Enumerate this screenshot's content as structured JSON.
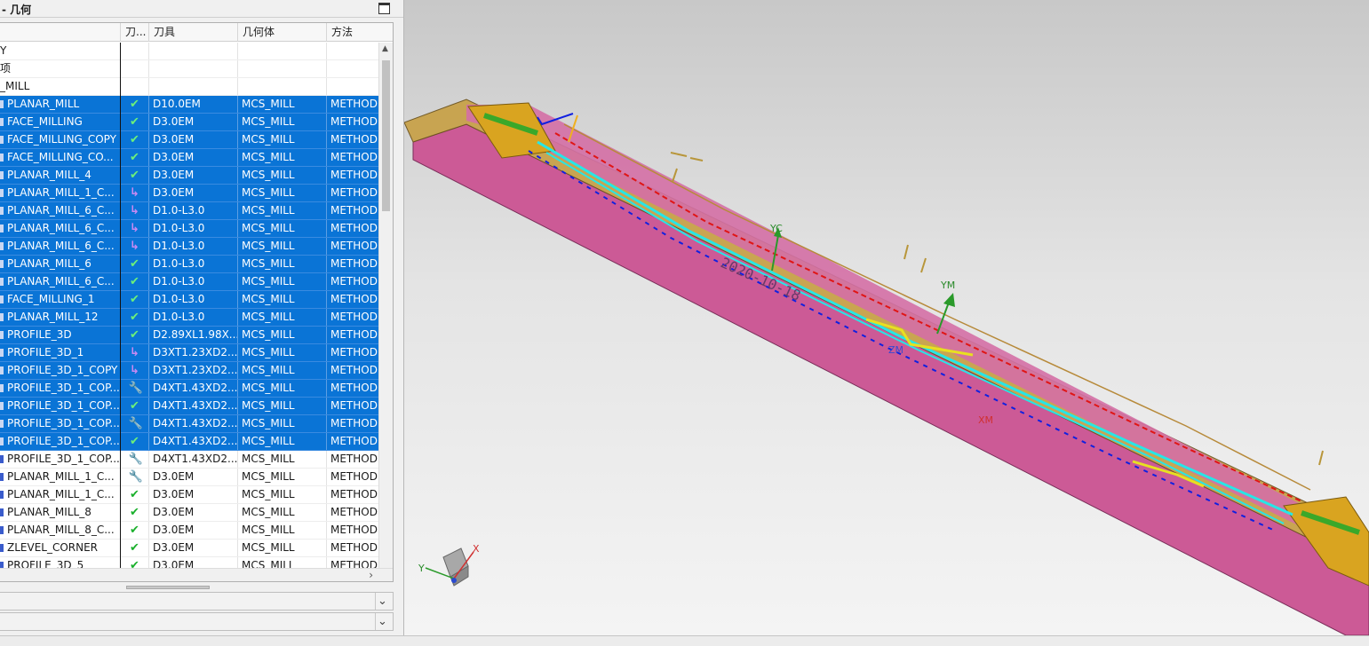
{
  "navigator": {
    "title": "- 几何",
    "columns": [
      "",
      "刀...",
      "刀具",
      "几何体",
      "方法"
    ]
  },
  "rows": [
    {
      "name": "Y",
      "status": "",
      "tool": "",
      "geometry": "",
      "method": "",
      "selected": false,
      "group": true
    },
    {
      "name": "项",
      "status": "",
      "tool": "",
      "geometry": "",
      "method": "",
      "selected": false,
      "group": true
    },
    {
      "name": "_MILL",
      "status": "",
      "tool": "",
      "geometry": "",
      "method": "",
      "selected": false,
      "group": true
    },
    {
      "name": "PLANAR_MILL",
      "status": "✔",
      "tool": "D10.0EM",
      "geometry": "MCS_MILL",
      "method": "METHOD",
      "selected": true,
      "kind": "ok"
    },
    {
      "name": "FACE_MILLING",
      "status": "✔",
      "tool": "D3.0EM",
      "geometry": "MCS_MILL",
      "method": "METHOD",
      "selected": true,
      "kind": "ok"
    },
    {
      "name": "FACE_MILLING_COPY",
      "status": "✔",
      "tool": "D3.0EM",
      "geometry": "MCS_MILL",
      "method": "METHOD",
      "selected": true,
      "kind": "ok"
    },
    {
      "name": "FACE_MILLING_CO...",
      "status": "✔",
      "tool": "D3.0EM",
      "geometry": "MCS_MILL",
      "method": "METHOD",
      "selected": true,
      "kind": "ok"
    },
    {
      "name": "PLANAR_MILL_4",
      "status": "✔",
      "tool": "D3.0EM",
      "geometry": "MCS_MILL",
      "method": "METHOD",
      "selected": true,
      "kind": "ok"
    },
    {
      "name": "PLANAR_MILL_1_C...",
      "status": "↳",
      "tool": "D3.0EM",
      "geometry": "MCS_MILL",
      "method": "METHOD",
      "selected": true,
      "kind": "rep"
    },
    {
      "name": "PLANAR_MILL_6_C...",
      "status": "↳",
      "tool": "D1.0-L3.0",
      "geometry": "MCS_MILL",
      "method": "METHOD",
      "selected": true,
      "kind": "rep"
    },
    {
      "name": "PLANAR_MILL_6_C...",
      "status": "↳",
      "tool": "D1.0-L3.0",
      "geometry": "MCS_MILL",
      "method": "METHOD",
      "selected": true,
      "kind": "rep"
    },
    {
      "name": "PLANAR_MILL_6_C...",
      "status": "↳",
      "tool": "D1.0-L3.0",
      "geometry": "MCS_MILL",
      "method": "METHOD",
      "selected": true,
      "kind": "rep"
    },
    {
      "name": "PLANAR_MILL_6",
      "status": "✔",
      "tool": "D1.0-L3.0",
      "geometry": "MCS_MILL",
      "method": "METHOD",
      "selected": true,
      "kind": "ok"
    },
    {
      "name": "PLANAR_MILL_6_C...",
      "status": "✔",
      "tool": "D1.0-L3.0",
      "geometry": "MCS_MILL",
      "method": "METHOD",
      "selected": true,
      "kind": "ok"
    },
    {
      "name": "FACE_MILLING_1",
      "status": "✔",
      "tool": "D1.0-L3.0",
      "geometry": "MCS_MILL",
      "method": "METHOD",
      "selected": true,
      "kind": "ok"
    },
    {
      "name": "PLANAR_MILL_12",
      "status": "✔",
      "tool": "D1.0-L3.0",
      "geometry": "MCS_MILL",
      "method": "METHOD",
      "selected": true,
      "kind": "ok"
    },
    {
      "name": "PROFILE_3D",
      "status": "✔",
      "tool": "D2.89XL1.98X...",
      "geometry": "MCS_MILL",
      "method": "METHOD",
      "selected": true,
      "kind": "ok"
    },
    {
      "name": "PROFILE_3D_1",
      "status": "↳",
      "tool": "D3XT1.23XD2...",
      "geometry": "MCS_MILL",
      "method": "METHOD",
      "selected": true,
      "kind": "rep"
    },
    {
      "name": "PROFILE_3D_1_COPY",
      "status": "↳",
      "tool": "D3XT1.23XD2...",
      "geometry": "MCS_MILL",
      "method": "METHOD",
      "selected": true,
      "kind": "rep"
    },
    {
      "name": "PROFILE_3D_1_COP...",
      "status": "🔧",
      "tool": "D4XT1.43XD2...",
      "geometry": "MCS_MILL",
      "method": "METHOD",
      "selected": true,
      "kind": "tool"
    },
    {
      "name": "PROFILE_3D_1_COP...",
      "status": "✔",
      "tool": "D4XT1.43XD2...",
      "geometry": "MCS_MILL",
      "method": "METHOD",
      "selected": true,
      "kind": "ok"
    },
    {
      "name": "PROFILE_3D_1_COP...",
      "status": "🔧",
      "tool": "D4XT1.43XD2...",
      "geometry": "MCS_MILL",
      "method": "METHOD",
      "selected": true,
      "kind": "tool"
    },
    {
      "name": "PROFILE_3D_1_COP...",
      "status": "✔",
      "tool": "D4XT1.43XD2...",
      "geometry": "MCS_MILL",
      "method": "METHOD",
      "selected": true,
      "kind": "ok"
    },
    {
      "name": "PROFILE_3D_1_COP...",
      "status": "🔧",
      "tool": "D4XT1.43XD2...",
      "geometry": "MCS_MILL",
      "method": "METHOD",
      "selected": false,
      "kind": "tool"
    },
    {
      "name": "PLANAR_MILL_1_C...",
      "status": "🔧",
      "tool": "D3.0EM",
      "geometry": "MCS_MILL",
      "method": "METHOD",
      "selected": false,
      "kind": "tool"
    },
    {
      "name": "PLANAR_MILL_1_C...",
      "status": "✔",
      "tool": "D3.0EM",
      "geometry": "MCS_MILL",
      "method": "METHOD",
      "selected": false,
      "kind": "ok"
    },
    {
      "name": "PLANAR_MILL_8",
      "status": "✔",
      "tool": "D3.0EM",
      "geometry": "MCS_MILL",
      "method": "METHOD",
      "selected": false,
      "kind": "ok"
    },
    {
      "name": "PLANAR_MILL_8_C...",
      "status": "✔",
      "tool": "D3.0EM",
      "geometry": "MCS_MILL",
      "method": "METHOD",
      "selected": false,
      "kind": "ok"
    },
    {
      "name": "ZLEVEL_CORNER",
      "status": "✔",
      "tool": "D3.0EM",
      "geometry": "MCS_MILL",
      "method": "METHOD",
      "selected": false,
      "kind": "ok"
    },
    {
      "name": "PROFILE_3D_5",
      "status": "✔",
      "tool": "D3.0EM",
      "geometry": "MCS_MILL",
      "method": "METHOD",
      "selected": false,
      "kind": "ok"
    }
  ],
  "viewport": {
    "labels": {
      "yc": "YC",
      "ym": "YM",
      "xm": "XM",
      "zm": "ZM",
      "engraving": "2020-10-18"
    },
    "triad": {
      "x": "X",
      "y": "Y"
    }
  },
  "colors": {
    "selection": "#0a74d6",
    "part": "#cc5a96",
    "toolpath_cyan": "#27e6e6",
    "toolpath_blue": "#1020e0",
    "toolpath_red": "#e01515",
    "stock_gold": "#c8a24a"
  }
}
